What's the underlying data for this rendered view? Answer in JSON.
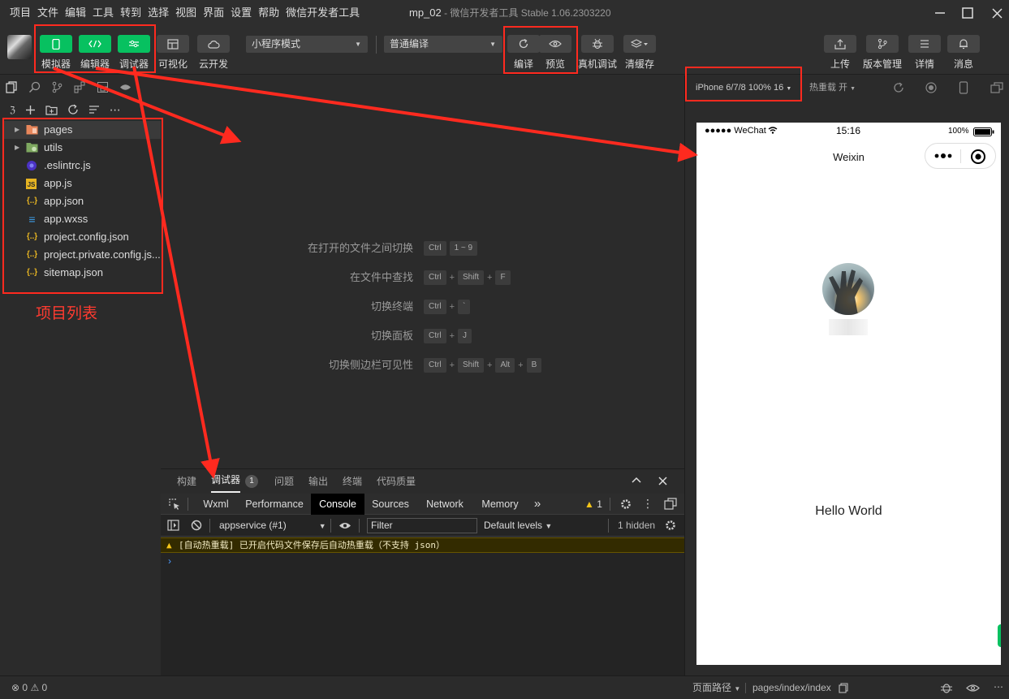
{
  "menubar": {
    "items": [
      "项目",
      "文件",
      "编辑",
      "工具",
      "转到",
      "选择",
      "视图",
      "界面",
      "设置",
      "帮助",
      "微信开发者工具"
    ],
    "title_project": "mp_02",
    "title_separator": " - ",
    "title_app": "微信开发者工具 Stable 1.06.2303220"
  },
  "toolbar": {
    "simulator": "模拟器",
    "editor": "编辑器",
    "debugger": "调试器",
    "visual": "可视化",
    "cloud": "云开发",
    "mode_select": "小程序模式",
    "compile_select": "普通编译",
    "compile": "编译",
    "preview": "预览",
    "remote_debug": "真机调试",
    "clear_cache": "清缓存",
    "upload": "上传",
    "version": "版本管理",
    "details": "详情",
    "messages": "消息",
    "brand_green": "#07c160"
  },
  "filetree": {
    "items": [
      {
        "name": "pages",
        "type": "folder"
      },
      {
        "name": "utils",
        "type": "folder"
      },
      {
        "name": ".eslintrc.js",
        "type": "eslint"
      },
      {
        "name": "app.js",
        "type": "js"
      },
      {
        "name": "app.json",
        "type": "json"
      },
      {
        "name": "app.wxss",
        "type": "wxss"
      },
      {
        "name": "project.config.json",
        "type": "json"
      },
      {
        "name": "project.private.config.js...",
        "type": "json"
      },
      {
        "name": "sitemap.json",
        "type": "json"
      }
    ]
  },
  "annotation": {
    "project_list": "项目列表",
    "color": "#ff2a1f"
  },
  "shortcuts": [
    {
      "label": "在打开的文件之间切换",
      "keys": [
        "Ctrl",
        "1 ~ 9"
      ]
    },
    {
      "label": "在文件中查找",
      "keys": [
        "Ctrl",
        "+",
        "Shift",
        "+",
        "F"
      ]
    },
    {
      "label": "切换终端",
      "keys": [
        "Ctrl",
        "+",
        "`"
      ]
    },
    {
      "label": "切换面板",
      "keys": [
        "Ctrl",
        "+",
        "J"
      ]
    },
    {
      "label": "切换侧边栏可见性",
      "keys": [
        "Ctrl",
        "+",
        "Shift",
        "+",
        "Alt",
        "+",
        "B"
      ]
    }
  ],
  "debugger": {
    "tabs": [
      "构建",
      "调试器",
      "问题",
      "输出",
      "终端",
      "代码质量"
    ],
    "badge": "1",
    "devtools_tabs": [
      "Wxml",
      "Performance",
      "Console",
      "Sources",
      "Network",
      "Memory"
    ],
    "more": "»",
    "warn_count": "1",
    "context": "appservice (#1)",
    "filter_placeholder": "Filter",
    "levels": "Default levels",
    "hidden": "1 hidden",
    "warning_message": "[自动热重载] 已开启代码文件保存后自动热重载（不支持 json）",
    "prompt": "›"
  },
  "simulator": {
    "device": "iPhone 6/7/8 100% 16",
    "hot_reload": "热重载 开",
    "status_carrier": "●●●●● WeChat",
    "status_time": "15:16",
    "status_battery": "100%",
    "nav_title": "Weixin",
    "hello": "Hello World"
  },
  "statusbar": {
    "errors": "0",
    "warnings": "0",
    "page_path_label": "页面路径",
    "page_path": "pages/index/index"
  }
}
